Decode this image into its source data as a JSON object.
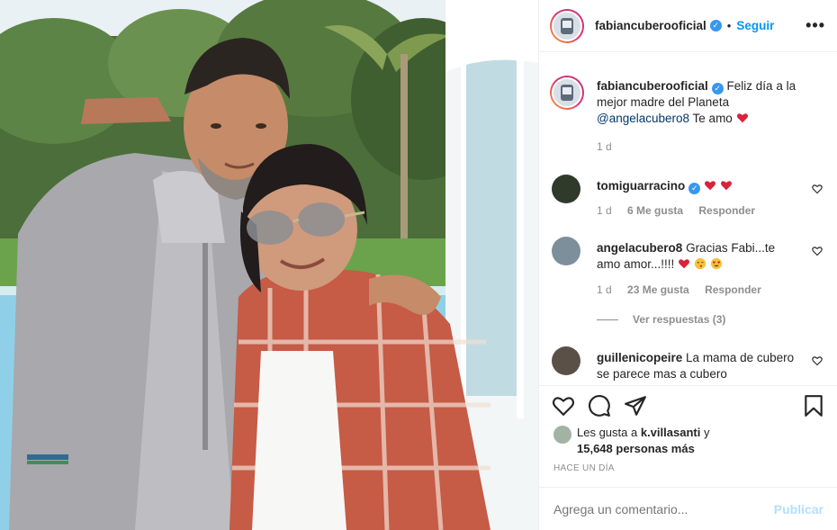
{
  "post": {
    "author": "fabiancuberooficial",
    "follow_label": "Seguir",
    "separator": "•",
    "more_label": "•••"
  },
  "caption": {
    "username": "fabiancuberooficial",
    "text": "Feliz día a la mejor madre del Planeta",
    "mention": "@angelacubero8",
    "text_after": "Te amo",
    "time": "1 d"
  },
  "comments": [
    {
      "username": "tomiguarracino",
      "text": "",
      "time": "1 d",
      "likes": "6 Me gusta",
      "reply_label": "Responder",
      "verified": true
    },
    {
      "username": "angelacubero8",
      "text": "Gracias Fabi...te amo amor...!!!!",
      "time": "1 d",
      "likes": "23 Me gusta",
      "reply_label": "Responder"
    },
    {
      "username": "guillenicopeire",
      "text": "La mama de cubero se parece mas a cubero"
    }
  ],
  "view_replies": "Ver respuestas (3)",
  "likes": {
    "prefix": "Les gusta a",
    "user": "k.villasanti",
    "conj": "y",
    "count": "15,648 personas más"
  },
  "timestamp": "HACE UN DÍA",
  "add_comment": {
    "placeholder": "Agrega un comentario...",
    "publish_label": "Publicar"
  },
  "colors": {
    "accent": "#0095f6",
    "verified": "#3897f0",
    "heart": "#ed4956",
    "publish_disabled": "#b2dffc"
  }
}
